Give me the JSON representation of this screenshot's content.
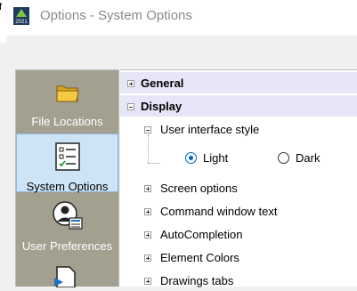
{
  "window": {
    "title": "Options - System Options",
    "app_icon_text": "2021",
    "background_fragment": "f"
  },
  "sidebar": {
    "items": [
      {
        "label": "File Locations",
        "icon": "folder-icon",
        "selected": false
      },
      {
        "label": "System Options",
        "icon": "checklist-icon",
        "selected": true
      },
      {
        "label": "User Preferences",
        "icon": "user-preferences-icon",
        "selected": false
      },
      {
        "label": "",
        "icon": "document-arrow-icon",
        "selected": false
      }
    ]
  },
  "tree": {
    "categories": [
      {
        "label": "General",
        "expanded": false
      },
      {
        "label": "Display",
        "expanded": true
      }
    ],
    "display": {
      "ui_style": {
        "label": "User interface style",
        "expanded": true,
        "options": [
          {
            "label": "Light",
            "selected": true
          },
          {
            "label": "Dark",
            "selected": false
          }
        ]
      },
      "items": [
        {
          "label": "Screen options"
        },
        {
          "label": "Command window text"
        },
        {
          "label": "AutoCompletion"
        },
        {
          "label": "Element Colors"
        },
        {
          "label": "Drawings tabs"
        }
      ]
    }
  },
  "colors": {
    "sidebar_bg": "#a4a090",
    "selected_bg": "#cde4f7",
    "category_bg": "#e6e6f8",
    "radio_accent": "#0067c0"
  }
}
